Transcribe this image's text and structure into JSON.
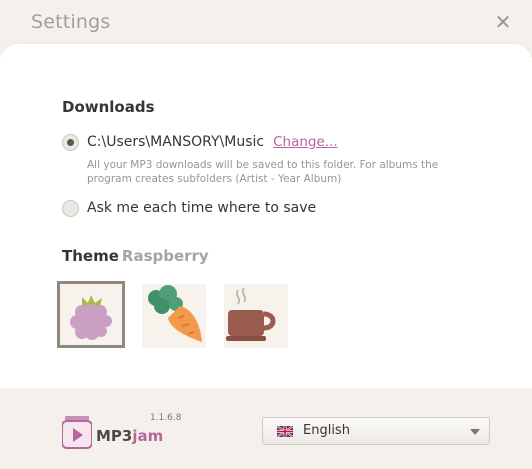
{
  "window": {
    "title": "Settings"
  },
  "downloads": {
    "section_title": "Downloads",
    "path_label": "C:\\Users\\MANSORY\\Music",
    "change_link": "Change...",
    "hint_line1": "All your MP3 downloads will be saved to this folder. For albums the",
    "hint_line2": "program creates subfolders (Artist - Year Album)",
    "ask_label": "Ask me each time where to save",
    "selected_option": "path"
  },
  "theme": {
    "section_title": "Theme",
    "current": "Raspberry",
    "options": [
      "raspberry-icon",
      "carrot-icon",
      "coffee-cup-icon"
    ],
    "selected": 0
  },
  "footer": {
    "brand_prefix": "MP3",
    "brand_suffix": "jam",
    "version": "1.1.6.8",
    "language": "English",
    "language_flag": "uk-flag-icon"
  },
  "colors": {
    "accent": "#b5679a",
    "header_bg": "#f4f1ec",
    "selected_border": "#8f887f"
  }
}
